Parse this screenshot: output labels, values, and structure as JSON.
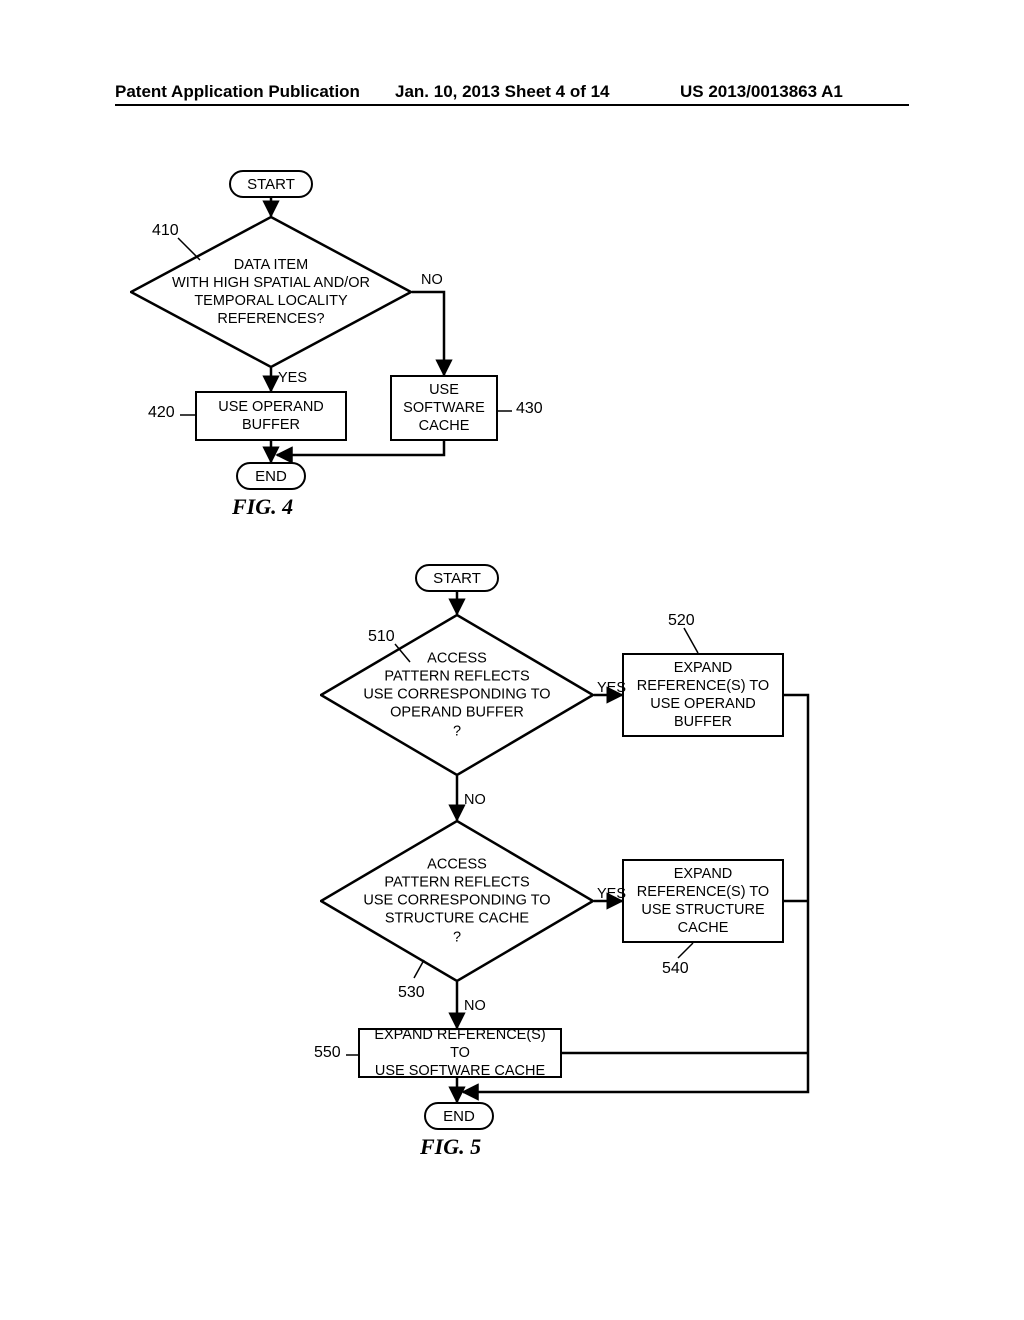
{
  "header": {
    "left": "Patent Application Publication",
    "center": "Jan. 10, 2013  Sheet 4 of 14",
    "right": "US 2013/0013863 A1"
  },
  "fig4": {
    "caption": "FIG. 4",
    "start": "START",
    "end": "END",
    "decision410": "DATA ITEM\nWITH HIGH SPATIAL AND/OR\nTEMPORAL LOCALITY\nREFERENCES?",
    "box420": "USE OPERAND\nBUFFER",
    "box430": "USE\nSOFTWARE\nCACHE",
    "yes": "YES",
    "no": "NO",
    "ref410": "410",
    "ref420": "420",
    "ref430": "430"
  },
  "fig5": {
    "caption": "FIG. 5",
    "start": "START",
    "end": "END",
    "decision510": "ACCESS\nPATTERN REFLECTS\nUSE CORRESPONDING TO\nOPERAND BUFFER\n?",
    "decision530": "ACCESS\nPATTERN REFLECTS\nUSE CORRESPONDING TO\nSTRUCTURE CACHE\n?",
    "box520": "EXPAND\nREFERENCE(S) TO\nUSE OPERAND\nBUFFER",
    "box540": "EXPAND\nREFERENCE(S) TO\nUSE STRUCTURE\nCACHE",
    "box550": "EXPAND REFERENCE(S) TO\nUSE SOFTWARE CACHE",
    "yes": "YES",
    "no": "NO",
    "ref510": "510",
    "ref520": "520",
    "ref530": "530",
    "ref540": "540",
    "ref550": "550"
  }
}
